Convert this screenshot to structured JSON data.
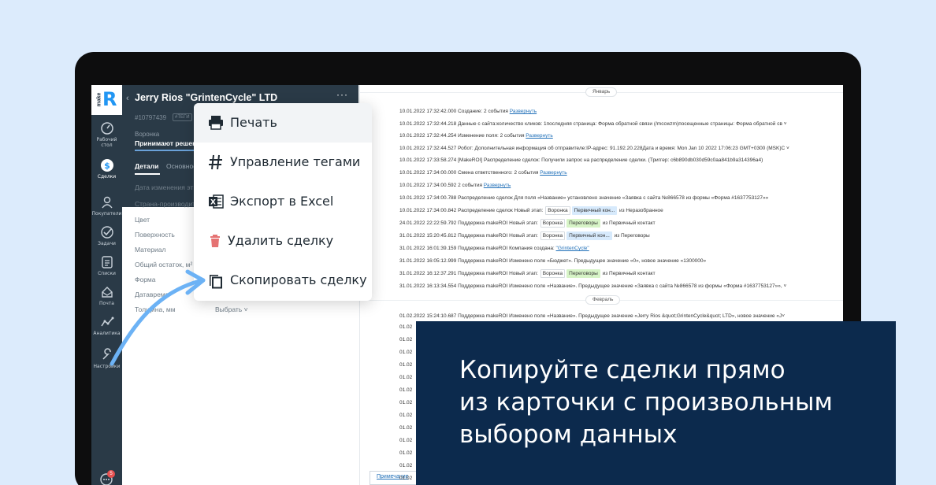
{
  "app": {
    "logo_text": "make"
  },
  "nav": {
    "items": [
      {
        "label": "Рабочий стол",
        "icon": "dashboard-icon"
      },
      {
        "label": "Сделки",
        "icon": "deals-dollar-icon"
      },
      {
        "label": "Покупатели",
        "icon": "customers-icon"
      },
      {
        "label": "Задачи",
        "icon": "tasks-check-icon"
      },
      {
        "label": "Списки",
        "icon": "lists-icon"
      },
      {
        "label": "Почта",
        "icon": "mail-icon"
      },
      {
        "label": "Аналитика",
        "icon": "analytics-icon"
      },
      {
        "label": "Настройки",
        "icon": "settings-icon"
      }
    ],
    "chat_badge": "5"
  },
  "card": {
    "title": "Jerry Rios \"GrintenCycle\" LTD",
    "id": "#10797439",
    "tag": "#ТЕГИ",
    "funnel_label": "Воронка",
    "stage": "Принимают решение",
    "tabs": [
      "Детали",
      "Основное"
    ],
    "fields": [
      "Дата изменения эт",
      "Страна-производит",
      "Цвет",
      "Поверхность",
      "Материал",
      "Общий остаток, м²",
      "Форма",
      "Датавремя",
      "Толщина, мм"
    ],
    "choose_label": "Выбрать"
  },
  "menu": {
    "items": [
      {
        "label": "Печать",
        "icon": "printer-icon"
      },
      {
        "label": "Управление тегами",
        "icon": "hashtag-icon"
      },
      {
        "label": "Экспорт в Excel",
        "icon": "excel-icon"
      },
      {
        "label": "Удалить сделку",
        "icon": "trash-icon"
      },
      {
        "label": "Скопировать сделку",
        "icon": "copy-icon"
      }
    ]
  },
  "feed": {
    "months": [
      "Январь",
      "Февраль"
    ],
    "rows": [
      {
        "text": "10.01.2022 17:32:42.000 Создание: 2 события ",
        "link": "Развернуть"
      },
      {
        "text": "10.01.2022 17:32:44.218 Данные с сайта:количество кликов: 1последняя страница: Форма обратной связи (/mccwzm)посещенные страницы: Форма обратной св ˅"
      },
      {
        "text": "10.01.2022 17:32:44.254 Изменение поля: 2 события ",
        "link": "Развернуть"
      },
      {
        "text": "10.01.2022 17:32:44.527 Робот: Дополнительная информация об отправителе:IP-адрес: 91.192.20.228Дата и время: Mon Jan 10 2022 17:06:23 GMT+0300 (MSK)С ˅"
      },
      {
        "text": "10.01.2022 17:33:58.274 [MakeROI] Распределение сделок: Получили запрос на распределение сделки. (Триггер: c6b890db030d59c0aa841b9a314396a4)"
      },
      {
        "text": "10.01.2022 17:34:00.000 Смена ответственного: 2 события ",
        "link": "Развернуть"
      },
      {
        "text": "10.01.2022 17:34:00.592 2 события ",
        "link": "Развернуть"
      },
      {
        "text": "10.01.2022 17:34:00.788 Распределение сделок Для поля «Название» установлено значение «Заявка с сайта №866578 из формы «Форма #1637753127»»"
      },
      {
        "text": "10.01.2022 17:34:00.842 Распределение сделок Новый этап: ",
        "pills": [
          [
            "Воронка",
            ""
          ],
          [
            "Первичный кон...",
            "blue"
          ]
        ],
        "after": " из Неразобранное"
      },
      {
        "text": "24.01.2022 22:22:59.792 Поддержка makeROI Новый этап: ",
        "pills": [
          [
            "Воронка",
            ""
          ],
          [
            "Переговоры",
            "green"
          ]
        ],
        "after": " из Первичный контакт"
      },
      {
        "text": "31.01.2022 15:20:45.812 Поддержка makeROI Новый этап: ",
        "pills": [
          [
            "Воронка",
            ""
          ],
          [
            "Первичный кон...",
            "blue"
          ]
        ],
        "after": " из Переговоры"
      },
      {
        "text": "31.01.2022 16:01:39.159 Поддержка makeROI Компания создана: ",
        "link": "\"GrintenCycle\""
      },
      {
        "text": "31.01.2022 16:05:12.999 Поддержка makeROI Изменено поле «Бюджет». Предыдущее значение «0», новое значение «1300000»"
      },
      {
        "text": "31.01.2022 16:12:37.291 Поддержка makeROI Новый этап: ",
        "pills": [
          [
            "Воронка",
            ""
          ],
          [
            "Переговоры",
            "green"
          ]
        ],
        "after": " из Первичный контакт"
      },
      {
        "text": "31.01.2022 16:13:34.554 Поддержка makeROI Изменено поле «Название». Предыдущее значение «Заявка с сайта №866578 из формы «Форма #1637753127»», ˅"
      }
    ],
    "feb_row": "01.02.2022 15:24:10.687 Поддержка makeROI Изменено поле «Название». Предыдущее значение «Jerry Rios &quot;GrintenCycle&quot; LTD», новое значение «J˅",
    "stub_rows": [
      "01.02",
      "01.02",
      "01.02",
      "01.02",
      "01.02",
      "01.02",
      "01.02",
      "01.02",
      "01.02",
      "01.02",
      "01.02",
      "01.02",
      "01.02"
    ],
    "note_button": "Примечание"
  },
  "banner": {
    "lines": [
      "Копируйте сделки прямо",
      "из карточки с произвольным",
      "выбором данных"
    ],
    "bg_color": "#0c2a4d"
  }
}
